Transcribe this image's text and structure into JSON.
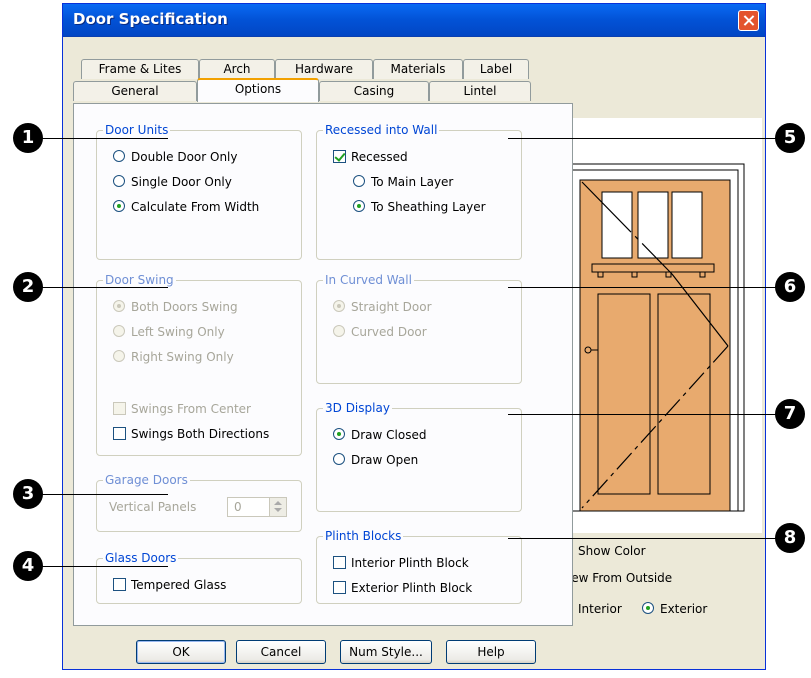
{
  "window": {
    "title": "Door Specification"
  },
  "tabs": {
    "row1": [
      "Frame & Lites",
      "Arch",
      "Hardware",
      "Materials",
      "Label"
    ],
    "row2": [
      "General",
      "Options",
      "Casing",
      "Lintel"
    ]
  },
  "door_units": {
    "title": "Door Units",
    "options": [
      "Double Door Only",
      "Single Door Only",
      "Calculate From Width"
    ],
    "selected": "Calculate From Width"
  },
  "door_swing": {
    "title": "Door Swing",
    "options": [
      "Both Doors Swing",
      "Left Swing Only",
      "Right Swing Only"
    ],
    "selected": "Both Doors Swing",
    "swings_from_center": "Swings From Center",
    "swings_both_directions": "Swings Both Directions"
  },
  "garage_doors": {
    "title": "Garage Doors",
    "label": "Vertical Panels",
    "value": "0"
  },
  "glass_doors": {
    "title": "Glass Doors",
    "tempered": "Tempered Glass"
  },
  "recessed": {
    "title": "Recessed into Wall",
    "checkbox": "Recessed",
    "options": [
      "To Main Layer",
      "To Sheathing Layer"
    ],
    "selected": "To Sheathing Layer"
  },
  "curved_wall": {
    "title": "In Curved Wall",
    "options": [
      "Straight Door",
      "Curved Door"
    ],
    "selected": "Straight Door"
  },
  "display_3d": {
    "title": "3D Display",
    "options": [
      "Draw Closed",
      "Draw Open"
    ],
    "selected": "Draw Closed"
  },
  "plinth": {
    "title": "Plinth Blocks",
    "interior": "Interior Plinth Block",
    "exterior": "Exterior Plinth Block"
  },
  "preview": {
    "show_color": "Show Color",
    "view_from": "View From Outside",
    "interior": "Interior",
    "exterior": "Exterior",
    "door_color": "#e8aa6e"
  },
  "buttons": {
    "ok": "OK",
    "cancel": "Cancel",
    "num_style": "Num Style...",
    "help": "Help"
  },
  "callouts": [
    "1",
    "2",
    "3",
    "4",
    "5",
    "6",
    "7",
    "8"
  ]
}
